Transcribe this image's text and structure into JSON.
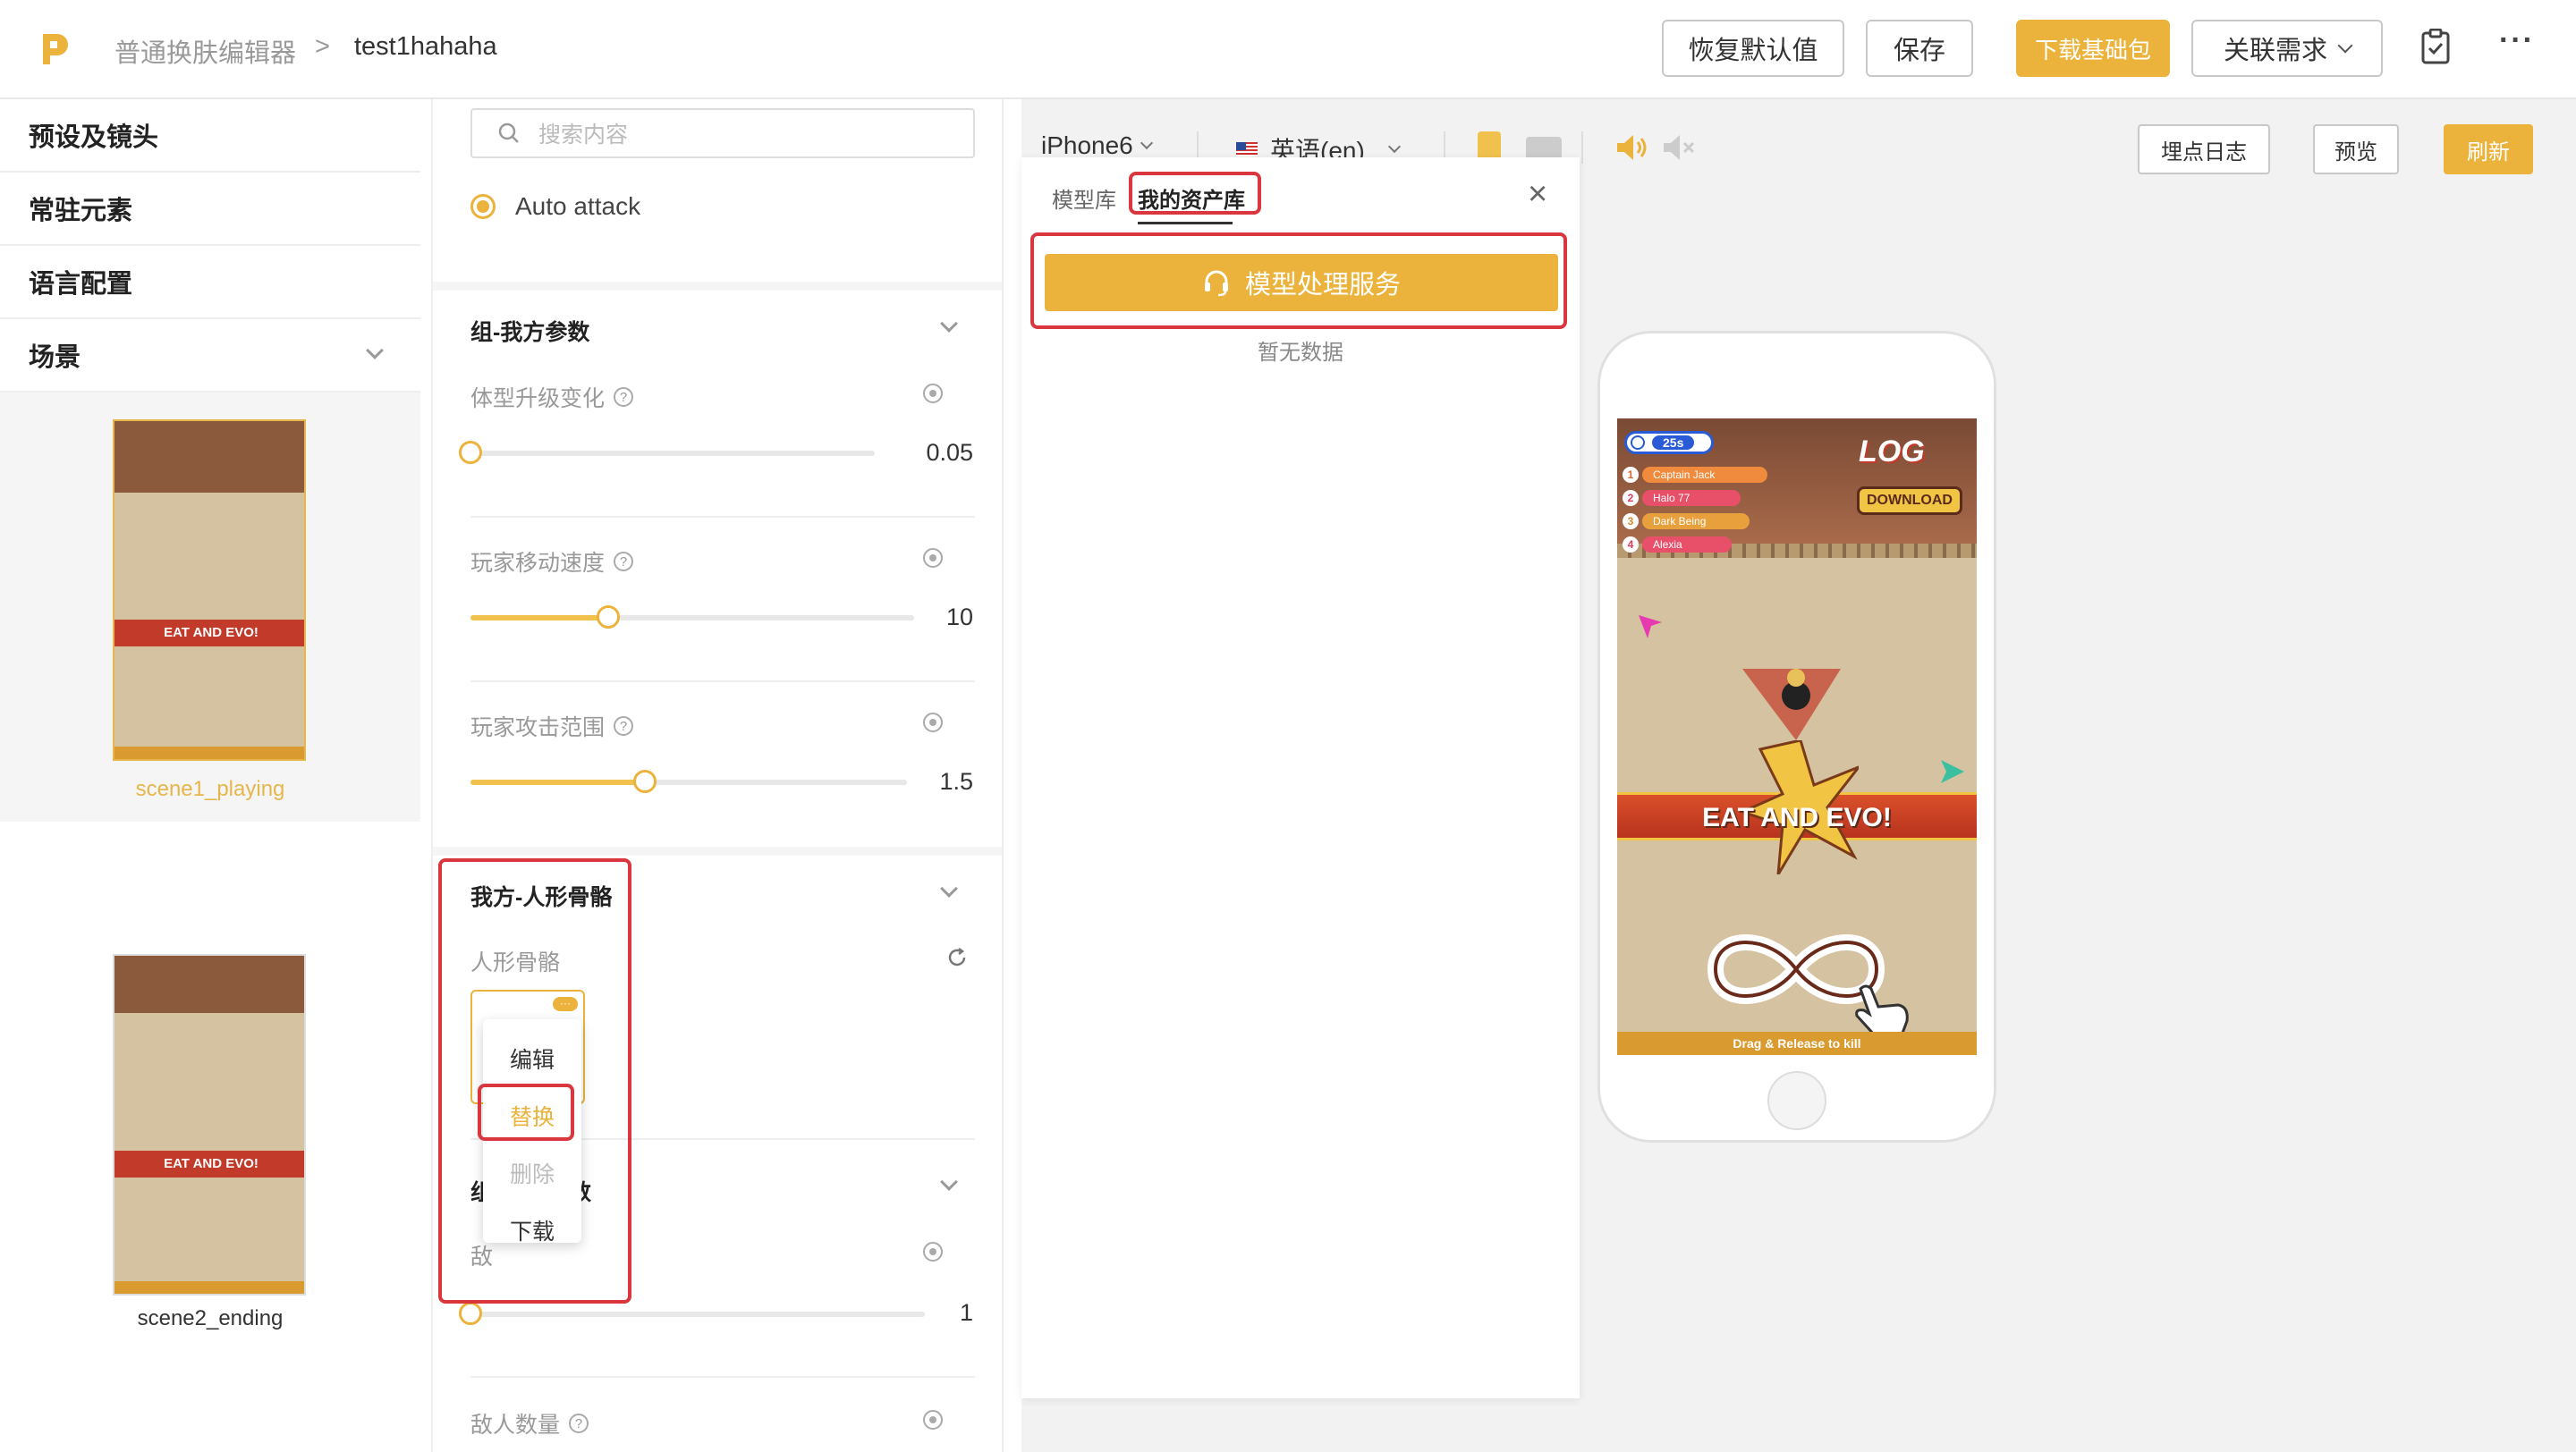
{
  "header": {
    "breadcrumb_root": "普通换肤编辑器",
    "breadcrumb_sep": ">",
    "breadcrumb_current": "test1hahaha",
    "btn_reset": "恢复默认值",
    "btn_save": "保存",
    "btn_download_base": "下载基础包",
    "btn_related": "关联需求",
    "more": "···"
  },
  "sidebar": {
    "items": [
      "预设及镜头",
      "常驻元素",
      "语言配置",
      "场景"
    ],
    "scenes": [
      {
        "label": "scene1_playing",
        "selected": true
      },
      {
        "label": "scene2_ending",
        "selected": false
      }
    ]
  },
  "params": {
    "search_placeholder": "搜索内容",
    "radio_label": "Auto attack",
    "group1": "组-我方参数",
    "p1_label": "体型升级变化",
    "p1_value": "0.05",
    "p1_fraction": 0.0,
    "p2_label": "玩家移动速度",
    "p2_value": "10",
    "p2_fraction": 0.31,
    "p3_label": "玩家攻击范围",
    "p3_value": "1.5",
    "p3_fraction": 0.4,
    "group2": "我方-人形骨骼",
    "bone_label": "人形骨骼",
    "group3_frag": "组",
    "group3_frag2": "数",
    "p4_frag": "敌",
    "p4_value": "1",
    "p4_fraction": 0.0,
    "p5_label": "敌人数量",
    "help_glyph": "?",
    "menu": [
      "编辑",
      "替换",
      "删除",
      "下载"
    ]
  },
  "preview": {
    "device": "iPhone6",
    "language": "英语(en)",
    "btn_log": "埋点日志",
    "btn_preview": "预览",
    "btn_refresh": "刷新"
  },
  "asset_panel": {
    "tab_models": "模型库",
    "tab_my_assets": "我的资产库",
    "service_button": "模型处理服务",
    "empty_text": "暂无数据",
    "close": "×"
  },
  "game": {
    "timer": "25s",
    "leaderboard": [
      "Captain Jack",
      "Halo 77",
      "Dark Being",
      "Alexia"
    ],
    "rank_numbers": [
      "1",
      "2",
      "3",
      "4"
    ],
    "banner": "EAT AND EVO!",
    "download": "DOWNLOAD",
    "logo_text": "LOG",
    "footer": "Drag & Release to kill"
  },
  "colors": {
    "accent": "#ebb33c",
    "highlight": "#d9363e"
  }
}
